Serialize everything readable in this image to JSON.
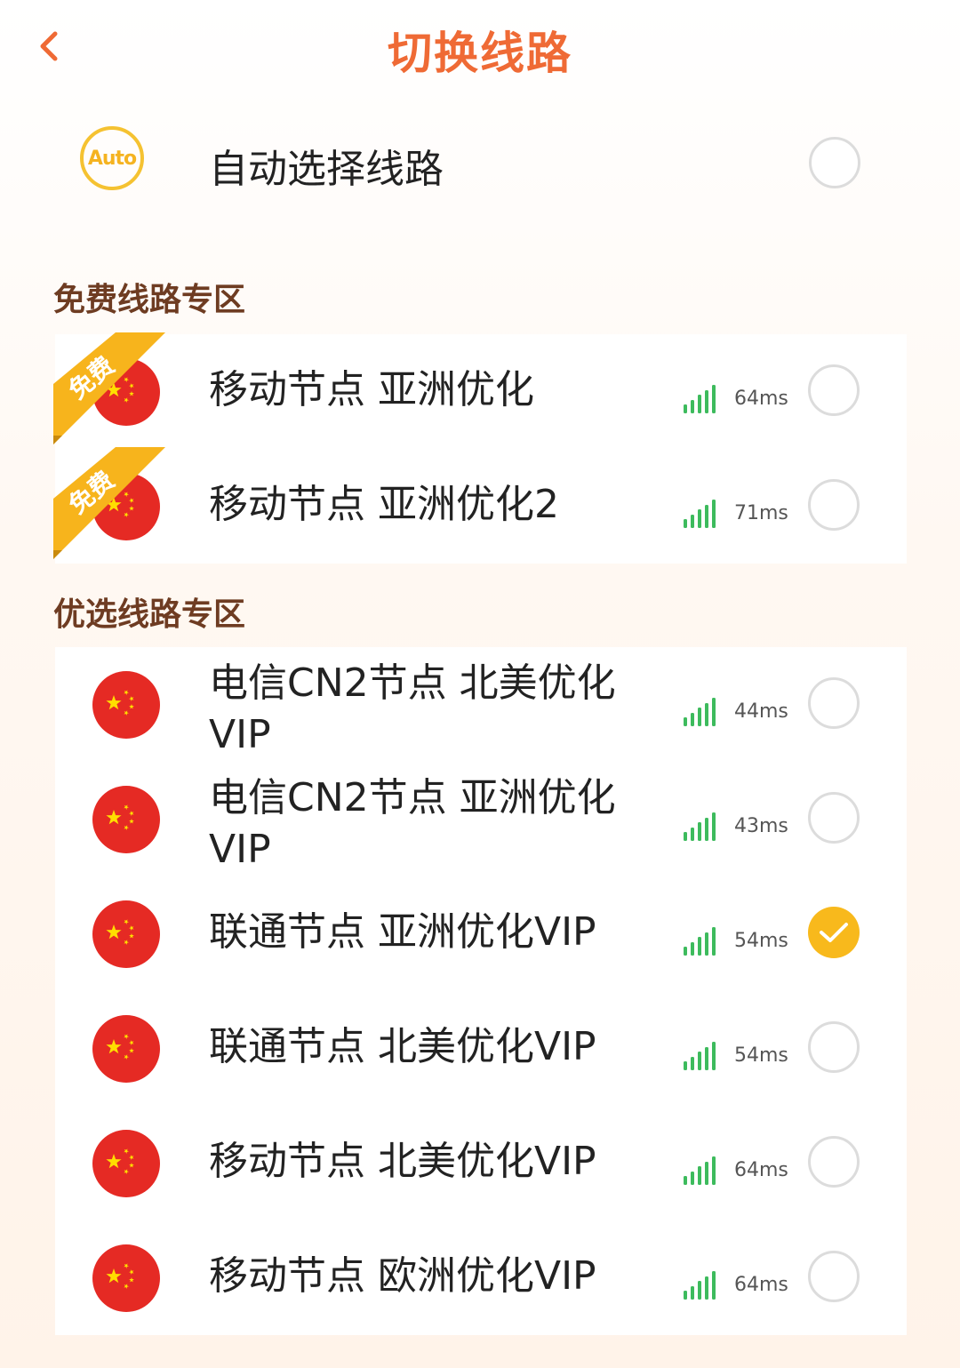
{
  "header": {
    "title": "切换线路"
  },
  "auto": {
    "badge": "Auto",
    "label": "自动选择线路"
  },
  "sections": {
    "free": "免费线路专区",
    "premium": "优选线路专区"
  },
  "free_ribbon": "免费",
  "free_lines": [
    {
      "name": "移动节点 亚洲优化",
      "latency": "64ms",
      "selected": false
    },
    {
      "name": "移动节点 亚洲优化2",
      "latency": "71ms",
      "selected": false
    }
  ],
  "premium_lines": [
    {
      "name": "电信CN2节点 北美优化VIP",
      "latency": "44ms",
      "selected": false
    },
    {
      "name": "电信CN2节点 亚洲优化VIP",
      "latency": "43ms",
      "selected": false
    },
    {
      "name": "联通节点 亚洲优化VIP",
      "latency": "54ms",
      "selected": true
    },
    {
      "name": "联通节点 北美优化VIP",
      "latency": "54ms",
      "selected": false
    },
    {
      "name": "移动节点 北美优化VIP",
      "latency": "64ms",
      "selected": false
    },
    {
      "name": "移动节点 欧洲优化VIP",
      "latency": "64ms",
      "selected": false
    }
  ],
  "colors": {
    "accent": "#ef6a35",
    "section": "#6e3c22",
    "selected": "#f8b91c",
    "signal": "#3dbb5d",
    "flag_red": "#e52a24",
    "flag_star": "#ffde00"
  },
  "icons": {
    "back": "chevron-left-icon",
    "signal": "signal-bars-icon",
    "check": "check-icon",
    "flag": "china-flag-icon"
  }
}
